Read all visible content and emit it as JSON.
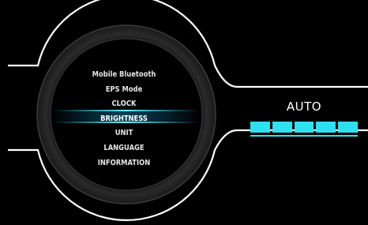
{
  "menu": {
    "items": [
      {
        "label": "Mobile Bluetooth",
        "selected": false
      },
      {
        "label": "EPS Mode",
        "selected": false
      },
      {
        "label": "CLOCK",
        "selected": false
      },
      {
        "label": "BRIGHTNESS",
        "selected": true
      },
      {
        "label": "UNIT",
        "selected": false
      },
      {
        "label": "LANGUAGE",
        "selected": false
      },
      {
        "label": "INFORMATION",
        "selected": false
      }
    ]
  },
  "brightness": {
    "mode": "AUTO",
    "level": 5,
    "max_level": 5
  },
  "colors": {
    "accent": "#2fe0f0",
    "background": "#000000",
    "frame": "#ffffff"
  }
}
